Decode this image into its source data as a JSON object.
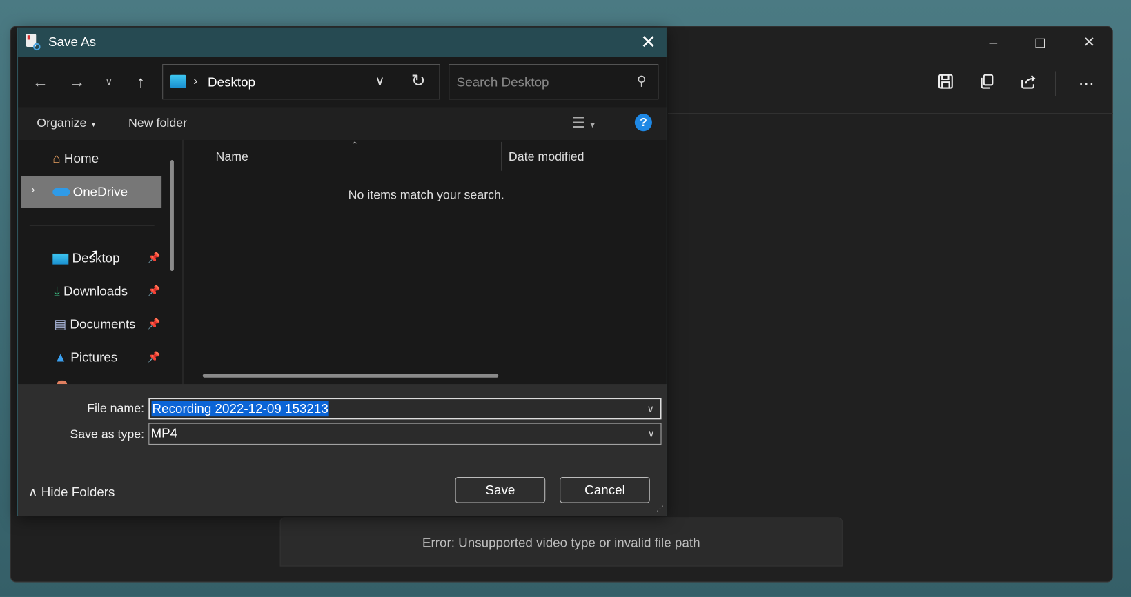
{
  "app": {
    "error": "Error: Unsupported video type or invalid file path",
    "window_controls": [
      "minimize",
      "maximize",
      "close"
    ],
    "toolbar_icons": [
      "save-icon",
      "copy-icon",
      "share-icon",
      "more-icon"
    ]
  },
  "dialog": {
    "title": "Save As",
    "address": {
      "location": "Desktop"
    },
    "search": {
      "placeholder": "Search Desktop"
    },
    "command_bar": {
      "organize": "Organize",
      "new_folder": "New folder"
    },
    "nav_pane": {
      "home": "Home",
      "onedrive": "OneDrive",
      "desktop": "Desktop",
      "downloads": "Downloads",
      "documents": "Documents",
      "pictures": "Pictures"
    },
    "columns": {
      "name": "Name",
      "date_modified": "Date modified"
    },
    "empty_message": "No items match your search.",
    "file_name_label": "File name:",
    "file_name": "Recording 2022-12-09 153213",
    "save_type_label": "Save as type:",
    "save_type": "MP4",
    "hide_folders": "Hide Folders",
    "save": "Save",
    "cancel": "Cancel"
  }
}
